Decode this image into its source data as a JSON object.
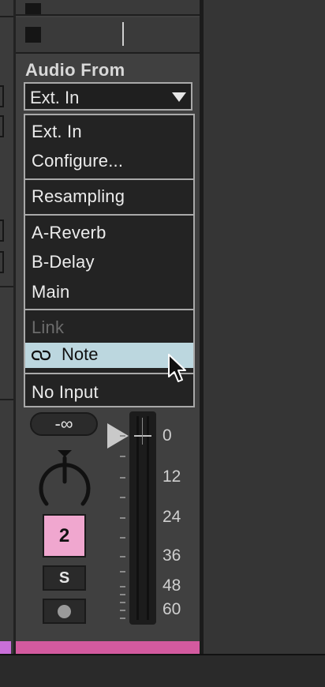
{
  "input_section": {
    "label": "Audio From",
    "selected_value": "Ext. In"
  },
  "dropdown": {
    "groups": [
      [
        "Ext. In",
        "Configure..."
      ],
      [
        "Resampling"
      ],
      [
        "A-Reverb",
        "B-Delay",
        "Main"
      ],
      [
        "Link",
        "Note"
      ],
      [
        "No Input"
      ]
    ],
    "disabled_item": "Link",
    "highlighted_item": "Note"
  },
  "mixer": {
    "volume_readout": "-∞",
    "track_number": "2",
    "solo_label": "S",
    "meter_scale": [
      "0",
      "12",
      "24",
      "36",
      "48",
      "60"
    ]
  },
  "colors": {
    "track_number_bg": "#f0a7cf",
    "highlight_bg": "#bcd7df",
    "clip_strip": "#d35a9f"
  },
  "icons": {
    "dropdown_arrow": "chevron-down-icon",
    "link_item": "link-icon",
    "pan": "pan-knob-icon",
    "arm": "record-arm-icon",
    "play": "play-icon",
    "cursor": "mouse-pointer-icon"
  }
}
